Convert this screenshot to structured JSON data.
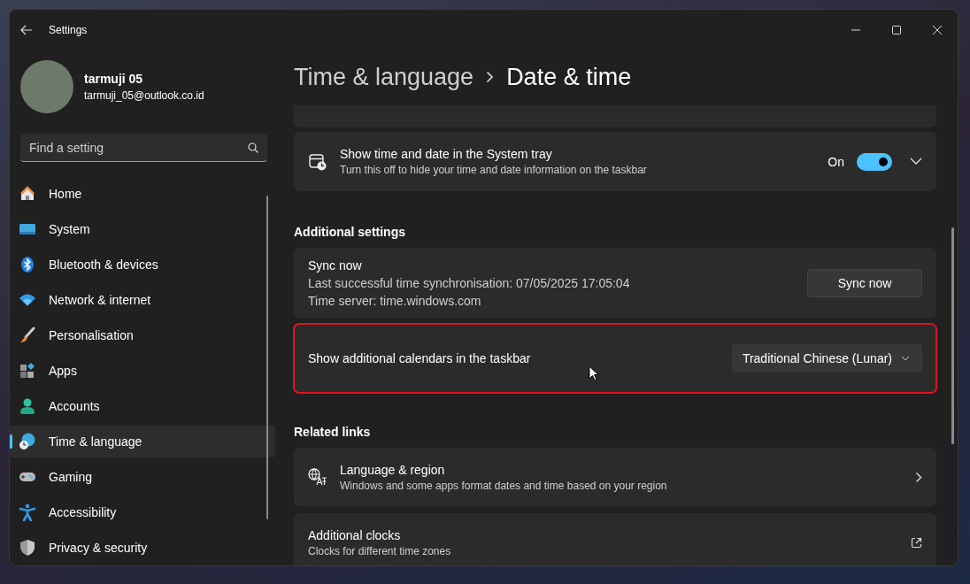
{
  "window": {
    "title": "Settings"
  },
  "account": {
    "name": "tarmuji 05",
    "email": "tarmuji_05@outlook.co.id"
  },
  "search": {
    "placeholder": "Find a setting"
  },
  "sidebar": {
    "items": [
      {
        "label": "Home",
        "selected": false
      },
      {
        "label": "System",
        "selected": false
      },
      {
        "label": "Bluetooth & devices",
        "selected": false
      },
      {
        "label": "Network & internet",
        "selected": false
      },
      {
        "label": "Personalisation",
        "selected": false
      },
      {
        "label": "Apps",
        "selected": false
      },
      {
        "label": "Accounts",
        "selected": false
      },
      {
        "label": "Time & language",
        "selected": true
      },
      {
        "label": "Gaming",
        "selected": false
      },
      {
        "label": "Accessibility",
        "selected": false
      },
      {
        "label": "Privacy & security",
        "selected": false
      }
    ]
  },
  "breadcrumb": {
    "parent": "Time & language",
    "current": "Date & time"
  },
  "tray_setting": {
    "title": "Show time and date in the System tray",
    "description": "Turn this off to hide your time and date information on the taskbar",
    "state_label": "On",
    "on": true,
    "expanded": false
  },
  "additional_settings": {
    "heading": "Additional settings",
    "sync": {
      "title": "Sync now",
      "lines": [
        "Last successful time synchronisation: 07/05/2025 17:05:04",
        "Time server: time.windows.com"
      ],
      "button": "Sync now"
    },
    "calendar": {
      "label": "Show additional calendars in the taskbar",
      "value": "Traditional Chinese (Lunar)",
      "highlighted": true
    }
  },
  "related_links": {
    "heading": "Related links",
    "items": [
      {
        "kind": "internal",
        "title": "Language & region",
        "description": "Windows and some apps format dates and time based on your region"
      },
      {
        "kind": "external",
        "title": "Additional clocks",
        "description": "Clocks for different time zones"
      }
    ]
  }
}
